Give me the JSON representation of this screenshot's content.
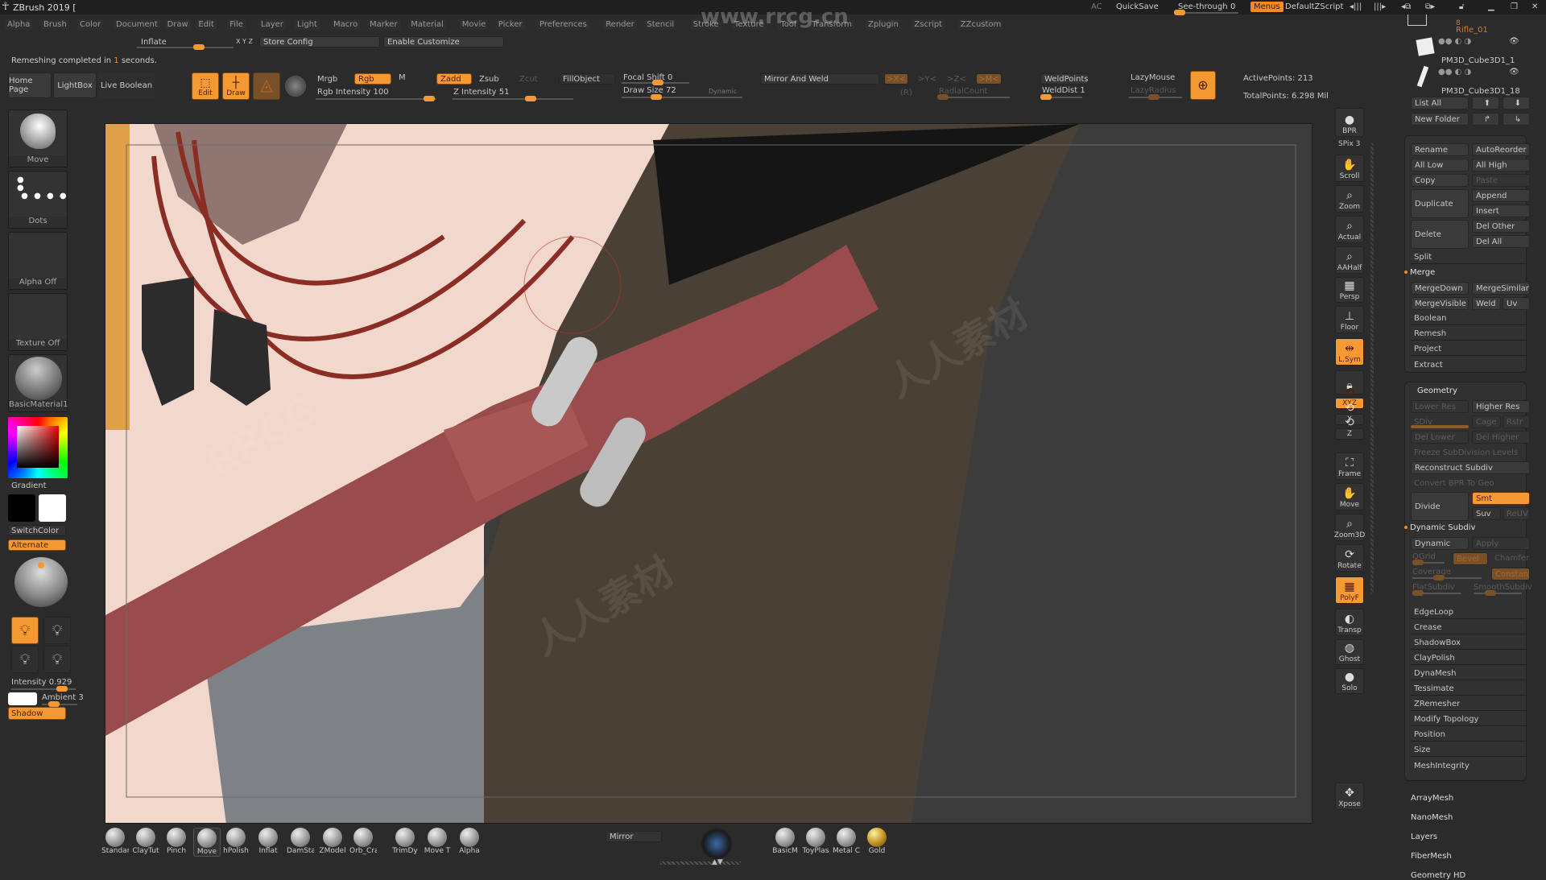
{
  "app": {
    "title": "ZBrush 2019 [",
    "watermark_url": "www.rrcg.cn",
    "watermark_text": "RRCG",
    "watermark_cn": "人人素材"
  },
  "titlebar_right": {
    "ac": "AC",
    "quicksave": "QuickSave",
    "see_through_label": "See-through",
    "see_through_value": "0",
    "see_through_fraction": 0.0,
    "menus": "Menus",
    "default_zscript": "DefaultZScript"
  },
  "menubar": [
    "Alpha",
    "Brush",
    "Color",
    "Document",
    "Draw",
    "Edit",
    "File",
    "Layer",
    "Light",
    "Macro",
    "Marker",
    "Material",
    "Movie",
    "Picker",
    "Preferences",
    "Render",
    "Stencil",
    "Stroke",
    "Texture",
    "Tool",
    "Transform",
    "Zplugin",
    "Zscript",
    "ZZcustom"
  ],
  "row2": {
    "inflate": "Inflate",
    "xyz": "X Y Z",
    "store_config": "Store Config",
    "enable_customize": "Enable Customize"
  },
  "status": {
    "prefix": "Remeshing completed in ",
    "seconds": "1",
    "suffix": " seconds."
  },
  "toolbar": {
    "home_page": "Home Page",
    "lightbox": "LightBox",
    "live_boolean": "Live Boolean",
    "edit": "Edit",
    "draw": "Draw",
    "mrgb": "Mrgb",
    "rgb": "Rgb",
    "m": "M",
    "rgb_intensity_label": "Rgb Intensity",
    "rgb_intensity": "100",
    "zadd": "Zadd",
    "zsub": "Zsub",
    "zcut": "Zcut",
    "z_intensity_label": "Z Intensity",
    "z_intensity": "51",
    "fillobject": "FillObject",
    "focal_shift_label": "Focal Shift",
    "focal_shift": "0",
    "draw_size_label": "Draw Size",
    "draw_size": "72",
    "dynamic": "Dynamic",
    "mirror_and_weld": "Mirror And Weld",
    "mx": ">X<",
    "my": ">Y<",
    "mz": ">Z<",
    "mm": ">M<",
    "r": "(R)",
    "radial_count": "RadialCount",
    "weld_points": "WeldPoints",
    "weld_dist_label": "WeldDist",
    "weld_dist": "1",
    "lazymouse": "LazyMouse",
    "lazyradius": "LazyRadius",
    "active_points": "ActivePoints: 213",
    "total_points": "TotalPoints: 6.298 Mil"
  },
  "leftpanel": {
    "brush": "Move",
    "stroke": "Dots",
    "alpha": "Alpha Off",
    "texture": "Texture Off",
    "material": "BasicMaterial1",
    "gradient": "Gradient",
    "switchcolor": "SwitchColor",
    "alternate": "Alternate",
    "intensity_label": "Intensity",
    "intensity": "0.929",
    "ambient_label": "Ambient",
    "ambient": "3",
    "shadow": "Shadow",
    "colors": {
      "main": "#ffffff",
      "secondary": "#000000"
    }
  },
  "rightshelf": [
    {
      "label": "BPR",
      "icon": "bpr-sphere-icon"
    },
    {
      "label": "SPix 3",
      "icon": "spix-slider"
    },
    {
      "label": "Scroll",
      "icon": "hand-scroll-icon"
    },
    {
      "label": "Zoom",
      "icon": "zoom-icon"
    },
    {
      "label": "Actual",
      "icon": "actual-size-icon"
    },
    {
      "label": "AAHalf",
      "icon": "aahalf-icon"
    },
    {
      "label": "Persp",
      "icon": "perspective-grid-icon"
    },
    {
      "label": "Floor",
      "icon": "floor-icon"
    },
    {
      "label": "L.Sym",
      "icon": "local-symmetry-icon",
      "active": true
    },
    {
      "label": "",
      "icon": "camera-lock-icon"
    },
    {
      "label": "XYZ",
      "icon": "rotate-xyz-icon",
      "active": true
    },
    {
      "label": "Y",
      "icon": "rotate-y-icon"
    },
    {
      "label": "Z",
      "icon": "rotate-z-icon"
    },
    {
      "label": "Frame",
      "icon": "frame-icon"
    },
    {
      "label": "Move",
      "icon": "move-hand-icon"
    },
    {
      "label": "Zoom3D",
      "icon": "zoom3d-icon"
    },
    {
      "label": "Rotate",
      "icon": "rotate-icon"
    },
    {
      "label": "PolyF",
      "icon": "polyframe-icon",
      "active": true
    },
    {
      "label": "Transp",
      "icon": "transparency-icon"
    },
    {
      "label": "Ghost",
      "icon": "ghost-icon"
    },
    {
      "label": "Solo",
      "icon": "solo-icon"
    },
    {
      "label": "Xpose",
      "icon": "xpose-icon"
    }
  ],
  "subtool": {
    "items": [
      {
        "name": "Rifle_01",
        "index": "8"
      },
      {
        "name": "PM3D_Cube3D1_1"
      },
      {
        "name": "PM3D_Cube3D1_18"
      }
    ],
    "list_all": "List All",
    "new_folder": "New Folder",
    "buttons": {
      "rename": "Rename",
      "autoreorder": "AutoReorder",
      "all_low": "All Low",
      "all_high": "All High",
      "copy": "Copy",
      "paste": "Paste",
      "duplicate": "Duplicate",
      "append": "Append",
      "insert": "Insert",
      "delete": "Delete",
      "del_other": "Del Other",
      "del_all": "Del All",
      "split": "Split",
      "merge": "Merge",
      "mergedown": "MergeDown",
      "mergesimilar": "MergeSimilar",
      "mergevisible": "MergeVisible",
      "weld": "Weld",
      "uv": "Uv",
      "boolean": "Boolean",
      "remesh": "Remesh",
      "project": "Project",
      "extract": "Extract"
    }
  },
  "geometry": {
    "title": "Geometry",
    "lower_res": "Lower Res",
    "higher_res": "Higher Res",
    "sdiv": "SDiv",
    "cage": "Cage",
    "rstr": "Rstr",
    "del_lower": "Del Lower",
    "del_higher": "Del Higher",
    "freeze": "Freeze SubDivision Levels",
    "reconstruct": "Reconstruct Subdiv",
    "convert_bpr": "Convert BPR To Geo",
    "divide": "Divide",
    "smt": "Smt",
    "suv": "Suv",
    "reuv": "ReUV",
    "dynamic_subdiv": "Dynamic Subdiv",
    "dynamic": "Dynamic",
    "apply": "Apply",
    "qgrid": "QGrid",
    "bevel": "Bevel",
    "chamfer": "Chamfer",
    "coverage": "Coverage",
    "constant": "Constant",
    "flatsubdiv": "FlatSubdiv",
    "smoothsubdiv": "SmoothSubdiv",
    "rows": [
      "EdgeLoop",
      "Crease",
      "ShadowBox",
      "ClayPolish",
      "DynaMesh",
      "Tessimate",
      "ZRemesher",
      "Modify Topology",
      "Position",
      "Size",
      "MeshIntegrity"
    ]
  },
  "tool_sections": [
    "ArrayMesh",
    "NanoMesh",
    "Layers",
    "FiberMesh",
    "Geometry HD"
  ],
  "bottom_brushes": [
    "Standar",
    "ClayTut",
    "Pinch",
    "Move",
    "hPolish",
    "Inflat",
    "DamSta",
    "ZModel",
    "Orb_Cra",
    "TrimDy",
    "Move T",
    "Alpha"
  ],
  "bottom_mirror": "Mirror",
  "bottom_materials": [
    "BasicM",
    "ToyPlas",
    "Metal C",
    "Gold"
  ]
}
